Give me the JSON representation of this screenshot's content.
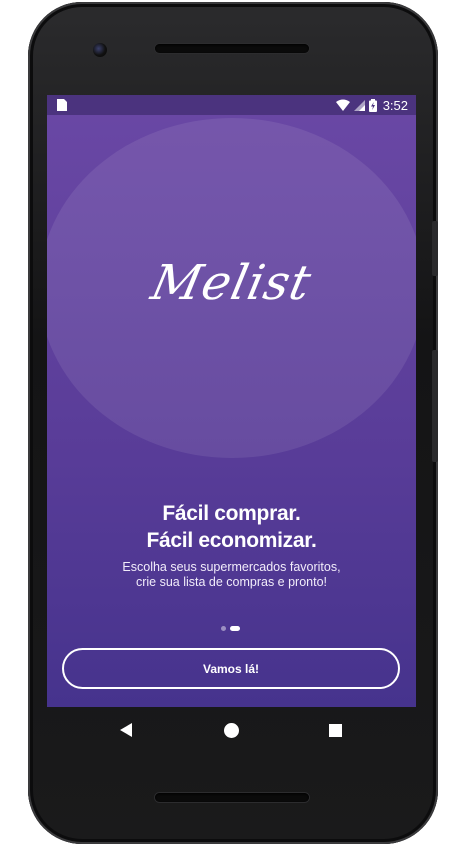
{
  "statusbar": {
    "time": "3:52",
    "icons": [
      "sim-card-icon",
      "wifi-icon",
      "signal-icon",
      "battery-charging-icon"
    ]
  },
  "onboarding": {
    "logo_text": "Melist",
    "headline_line1": "Fácil comprar.",
    "headline_line2": "Fácil economizar.",
    "subtitle_line1": "Escolha seus supermercados favoritos,",
    "subtitle_line2": "crie sua lista de compras e pronto!",
    "pager": {
      "count": 2,
      "active_index": 2
    },
    "cta_label": "Vamos lá!"
  },
  "navbar": {
    "icons": [
      "back-icon",
      "home-icon",
      "recents-icon"
    ]
  },
  "colors": {
    "accent": "#5a3d99",
    "statusbar": "#4b337e",
    "text": "#ffffff"
  }
}
